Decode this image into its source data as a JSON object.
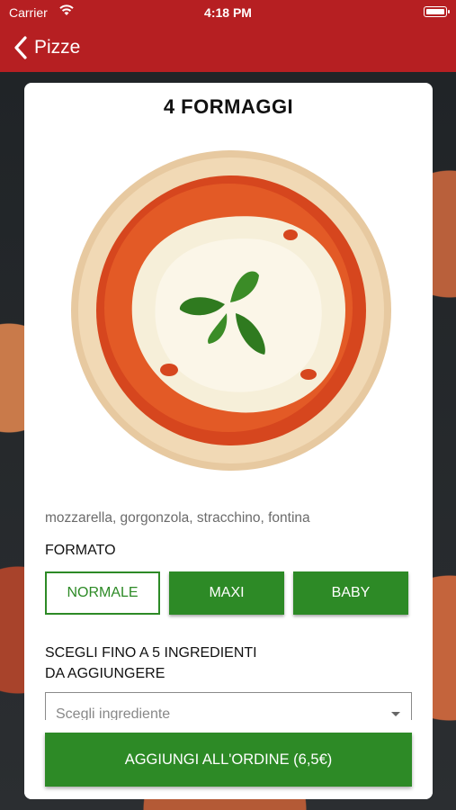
{
  "status_bar": {
    "carrier": "Carrier",
    "time": "4:18 PM"
  },
  "nav": {
    "back_label": "Pizze"
  },
  "product": {
    "title": "4 FORMAGGI",
    "description": "mozzarella, gorgonzola, stracchino, fontina"
  },
  "format": {
    "label": "FORMATO",
    "options": [
      "NORMALE",
      "MAXI",
      "BABY"
    ],
    "selected": "NORMALE"
  },
  "ingredients": {
    "label_line1": "SCEGLI FINO A 5 INGREDIENTI",
    "label_line2": "DA AGGIUNGERE",
    "placeholder": "Scegli ingrediente"
  },
  "add_button": {
    "label": "AGGIUNGI ALL'ORDINE (6,5€)"
  },
  "colors": {
    "header_red": "#b61f22",
    "accent_green": "#2d8a26"
  }
}
